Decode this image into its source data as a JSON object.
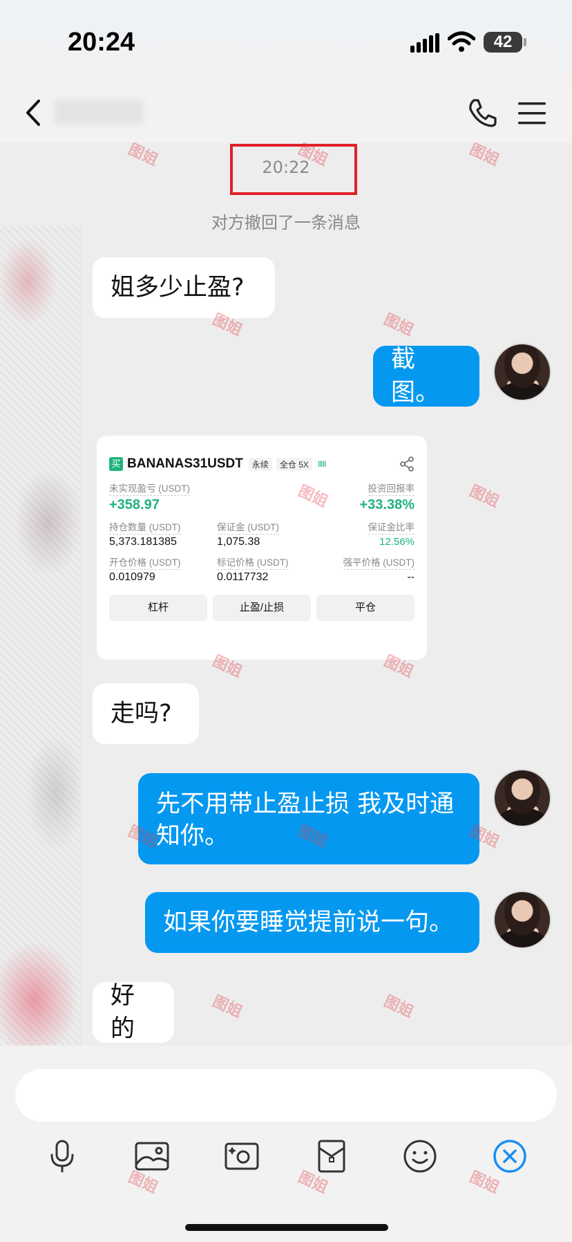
{
  "status_bar": {
    "time": "20:24",
    "battery": "42"
  },
  "nav": {
    "contact_name": ""
  },
  "chat": {
    "timestamp": "20:22",
    "recall_notice": "对方撤回了一条消息",
    "messages": [
      {
        "side": "in",
        "text": "姐多少止盈?"
      },
      {
        "side": "out",
        "text": "截图。"
      },
      {
        "side": "out",
        "type": "image"
      },
      {
        "side": "in",
        "text": "走吗?"
      },
      {
        "side": "out",
        "text": "先不用带止盈止损 我及时通知你。"
      },
      {
        "side": "out",
        "text": "如果你要睡觉提前说一句。"
      },
      {
        "side": "in",
        "text": "好的"
      }
    ]
  },
  "trade_card": {
    "buy_tag": "买",
    "symbol": "BANANAS31USDT",
    "contract": "永续",
    "margin_mode": "全仓 5X",
    "leverage_bars": "IIIII",
    "unrealized_pnl_label": "未实现盈亏 (USDT)",
    "unrealized_pnl": "+358.97",
    "roi_label": "投资回报率",
    "roi": "+33.38%",
    "position_qty_label": "持仓数量 (USDT)",
    "position_qty": "5,373.181385",
    "margin_label": "保证金 (USDT)",
    "margin": "1,075.38",
    "margin_ratio_label": "保证金比率",
    "margin_ratio": "12.56%",
    "entry_price_label": "开仓价格 (USDT)",
    "entry_price": "0.010979",
    "mark_price_label": "标记价格 (USDT)",
    "mark_price": "0.0117732",
    "liq_price_label": "强平价格 (USDT)",
    "liq_price": "--",
    "buttons": {
      "leverage": "杠杆",
      "tp_sl": "止盈/止损",
      "close": "平仓"
    }
  },
  "watermark_text": "图姐",
  "colors": {
    "outgoing_bubble": "#0598f0",
    "incoming_bubble": "#ffffff",
    "profit_green": "#1fb37a",
    "highlight_red": "#e0202b"
  },
  "input": {
    "placeholder": ""
  },
  "toolbar": [
    "microphone-icon",
    "image-icon",
    "camera-icon",
    "red-packet-icon",
    "emoji-icon",
    "close-icon"
  ]
}
